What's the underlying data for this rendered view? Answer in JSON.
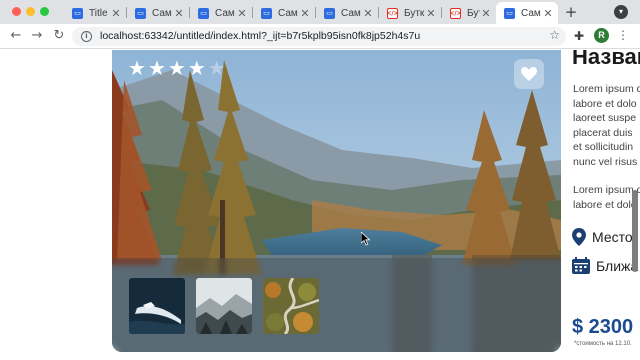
{
  "browser": {
    "tabs": [
      {
        "title": "Title",
        "favicon": "page-icon"
      },
      {
        "title": "Сам",
        "favicon": "page-icon"
      },
      {
        "title": "Сам",
        "favicon": "page-icon"
      },
      {
        "title": "Сам",
        "favicon": "page-icon"
      },
      {
        "title": "Сам",
        "favicon": "page-icon"
      },
      {
        "title": "Бутк",
        "favicon": "code-icon"
      },
      {
        "title": "Бутк",
        "favicon": "code-icon"
      },
      {
        "title": "Сам",
        "favicon": "page-icon",
        "active": true
      }
    ],
    "url": "localhost:63342/untitled/index.html?_ijt=b7r5kplb95isn0fk8jp52h4s7u",
    "profile_initial": "R"
  },
  "listing": {
    "rating": 4,
    "rating_max": 5,
    "title": "Назван",
    "description_lines": [
      "Lorem ipsum d",
      "labore et dolo",
      "laoreet suspe",
      "placerat duis",
      "et sollicitudin",
      "nunc vel risus"
    ],
    "description2_lines": [
      "Lorem ipsum d",
      "labore et dolo"
    ],
    "location_label": "Место",
    "date_label": "Ближа",
    "price": "$ 2300",
    "price_note": "*стоимость на 12.10.",
    "thumbnails": [
      "boat-on-water",
      "misty-forest-mountains",
      "aerial-road-autumn"
    ]
  },
  "colors": {
    "price": "#1c4a8f",
    "icon": "#1c3f73",
    "tab_strip": "#dfe1e5"
  }
}
